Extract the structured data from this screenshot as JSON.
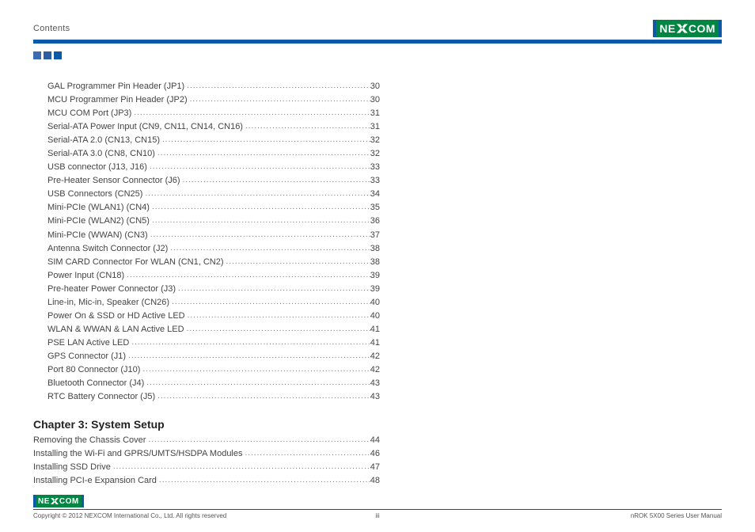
{
  "header": {
    "title": "Contents"
  },
  "logo": {
    "left": "NE",
    "right": "COM"
  },
  "toc": {
    "section_items": [
      {
        "label": "GAL Programmer Pin Header (JP1) ",
        "page": "30"
      },
      {
        "label": "MCU Programmer Pin Header (JP2)",
        "page": "30"
      },
      {
        "label": "MCU COM Port (JP3)",
        "page": "31"
      },
      {
        "label": "Serial-ATA Power Input (CN9, CN11, CN14, CN16)",
        "page": "31"
      },
      {
        "label": "Serial-ATA 2.0 (CN13, CN15)",
        "page": "32"
      },
      {
        "label": "Serial-ATA 3.0 (CN8, CN10)",
        "page": "32"
      },
      {
        "label": "USB connector (J13, J16) ",
        "page": "33"
      },
      {
        "label": "Pre-Heater Sensor Connector (J6)",
        "page": "33"
      },
      {
        "label": "USB Connectors (CN25)",
        "page": "34"
      },
      {
        "label": "Mini-PCIe (WLAN1) (CN4)",
        "page": "35"
      },
      {
        "label": "Mini-PCIe (WLAN2) (CN5)",
        "page": "36"
      },
      {
        "label": "Mini-PCIe (WWAN) (CN3)",
        "page": "37"
      },
      {
        "label": "Antenna Switch Connector (J2)",
        "page": "38"
      },
      {
        "label": "SIM CARD Connector For WLAN (CN1, CN2)",
        "page": "38"
      },
      {
        "label": "Power Input (CN18)",
        "page": "39"
      },
      {
        "label": "Pre-heater Power Connector (J3)",
        "page": "39"
      },
      {
        "label": "Line-in, Mic-in, Speaker (CN26)",
        "page": "40"
      },
      {
        "label": "Power On & SSD or HD Active LED",
        "page": "40"
      },
      {
        "label": "WLAN & WWAN & LAN Active LED",
        "page": "41"
      },
      {
        "label": "PSE LAN Active LED ",
        "page": "41"
      },
      {
        "label": "GPS Connector (J1)",
        "page": "42"
      },
      {
        "label": "Port 80 Connector (J10)",
        "page": "42"
      },
      {
        "label": "Bluetooth Connector (J4)",
        "page": "43"
      },
      {
        "label": "RTC Battery Connector (J5)",
        "page": "43"
      }
    ],
    "chapter_title": "Chapter 3: System Setup",
    "chapter_items": [
      {
        "label": "Removing the Chassis Cover",
        "page": "44"
      },
      {
        "label": "Installing the Wi-Fi and GPRS/UMTS/HSDPA Modules",
        "page": "46"
      },
      {
        "label": "Installing SSD Drive",
        "page": "47"
      },
      {
        "label": "Installing PCI-e Expansion Card",
        "page": "48"
      }
    ]
  },
  "footer": {
    "copyright": "Copyright © 2012 NEXCOM International Co., Ltd. All rights reserved",
    "page_no": "iii",
    "doc": "nROK 5X00 Series User Manual"
  }
}
